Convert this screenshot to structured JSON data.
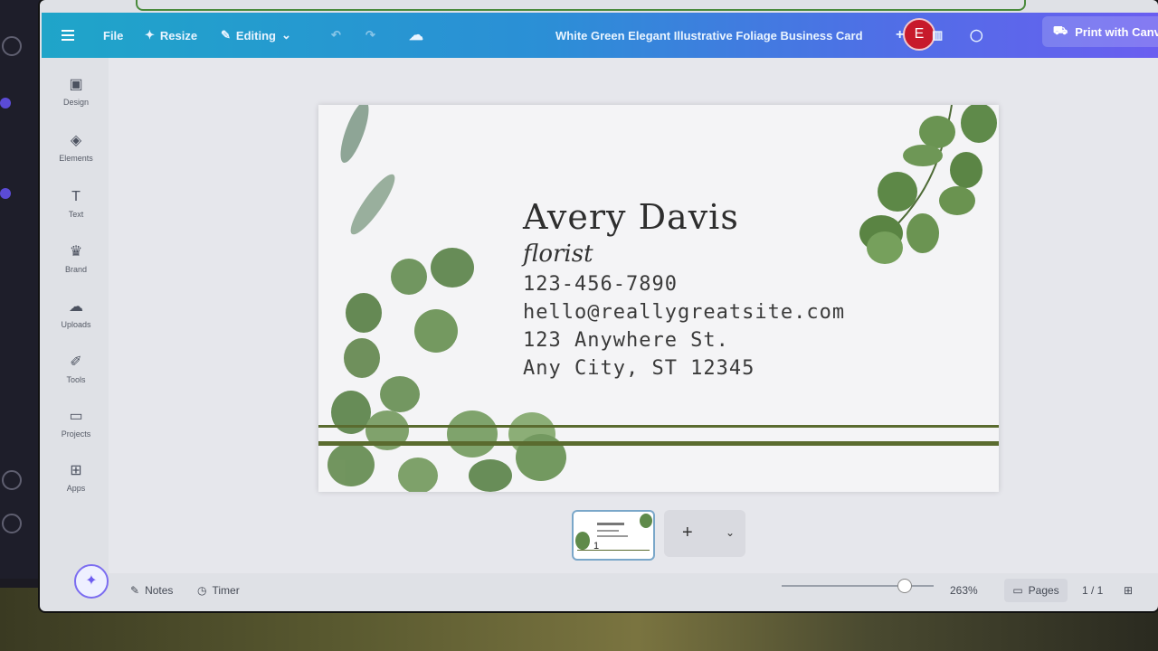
{
  "topbar": {
    "file_label": "File",
    "resize_label": "Resize",
    "editing_label": "Editing",
    "document_title": "White Green Elegant Illustrative Foliage Business Card",
    "avatar_letter": "E",
    "print_label": "Print with Canva"
  },
  "sidebar": {
    "items": [
      {
        "label": "Design",
        "icon": "design-icon"
      },
      {
        "label": "Elements",
        "icon": "elements-icon"
      },
      {
        "label": "Text",
        "icon": "text-icon"
      },
      {
        "label": "Brand",
        "icon": "brand-icon"
      },
      {
        "label": "Uploads",
        "icon": "uploads-icon"
      },
      {
        "label": "Tools",
        "icon": "tools-icon"
      },
      {
        "label": "Projects",
        "icon": "projects-icon"
      },
      {
        "label": "Apps",
        "icon": "apps-icon"
      }
    ]
  },
  "card": {
    "name": "Avery Davis",
    "role": "florist",
    "phone": "123-456-7890",
    "email": "hello@reallygreatsite.com",
    "address1": "123 Anywhere St.",
    "address2": "Any City, ST 12345"
  },
  "pages": {
    "thumb_number": "1",
    "add_label": "+"
  },
  "bottombar": {
    "notes_label": "Notes",
    "timer_label": "Timer",
    "zoom_value": "263%",
    "zoom_level": 0.79,
    "pages_label": "Pages",
    "page_count": "1 / 1"
  },
  "colors": {
    "topbar_start": "#1fa5c9",
    "topbar_end": "#6a5ef0",
    "avatar_bg": "#c71a2b",
    "leaf_green": "#5f8a4a"
  }
}
